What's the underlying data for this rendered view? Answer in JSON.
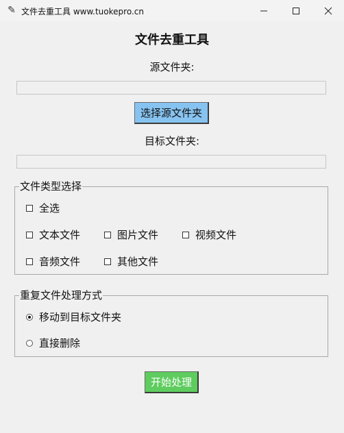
{
  "window": {
    "title": "文件去重工具  www.tuokepro.cn",
    "icon": "feather-icon"
  },
  "heading": "文件去重工具",
  "source": {
    "label": "源文件夹:",
    "value": "",
    "button_label": "选择源文件夹"
  },
  "target": {
    "label": "目标文件夹:",
    "value": ""
  },
  "file_types": {
    "legend": "文件类型选择",
    "options": [
      {
        "label": "全选",
        "checked": false
      },
      {
        "label": "文本文件",
        "checked": false
      },
      {
        "label": "图片文件",
        "checked": false
      },
      {
        "label": "视频文件",
        "checked": false
      },
      {
        "label": "音频文件",
        "checked": false
      },
      {
        "label": "其他文件",
        "checked": false
      }
    ]
  },
  "dup_mode": {
    "legend": "重复文件处理方式",
    "options": [
      {
        "label": "移动到目标文件夹",
        "selected": true
      },
      {
        "label": "直接删除",
        "selected": false
      }
    ]
  },
  "start_button_label": "开始处理",
  "colors": {
    "choose_button": "#87c3f0",
    "start_button": "#5ecc5e",
    "window_bg": "#f0f0f0"
  }
}
